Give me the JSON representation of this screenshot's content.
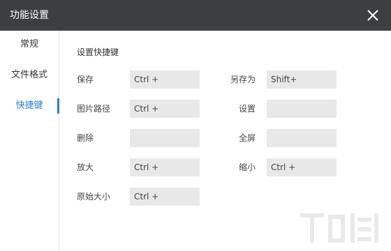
{
  "window": {
    "title": "功能设置"
  },
  "sidebar": {
    "items": [
      {
        "label": "常规",
        "active": false
      },
      {
        "label": "文件格式",
        "active": false
      },
      {
        "label": "快捷键",
        "active": true
      }
    ]
  },
  "main": {
    "section_title": "设置快捷键",
    "shortcuts": [
      {
        "label": "保存",
        "value": "Ctrl +"
      },
      {
        "label": "另存为",
        "value": "Shift+"
      },
      {
        "label": "图片路径",
        "value": "Ctrl +"
      },
      {
        "label": "设置",
        "value": ""
      },
      {
        "label": "删除",
        "value": ""
      },
      {
        "label": "全屏",
        "value": ""
      },
      {
        "label": "放大",
        "value": "Ctrl +"
      },
      {
        "label": "缩小",
        "value": "Ctrl +"
      },
      {
        "label": "原始大小",
        "value": "Ctrl +"
      }
    ]
  },
  "colors": {
    "titlebar": "#3b3f42",
    "accent": "#2b7fd6",
    "field_bg": "#e8e8e8"
  },
  "icons": {
    "close": "close-icon"
  }
}
